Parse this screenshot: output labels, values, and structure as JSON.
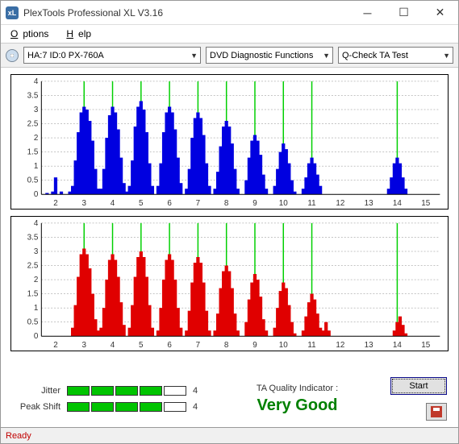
{
  "window": {
    "title": "PlexTools Professional XL V3.16"
  },
  "menu": {
    "options": "Options",
    "help": "Help"
  },
  "toolbar": {
    "device": "HA:7 ID:0   PX-760A",
    "function": "DVD Diagnostic Functions",
    "test": "Q-Check TA Test"
  },
  "chart_data": [
    {
      "type": "bar",
      "color": "#0000e0",
      "xlim": [
        1.5,
        15.5
      ],
      "ylim": [
        0,
        4
      ],
      "xticks": [
        2,
        3,
        4,
        5,
        6,
        7,
        8,
        9,
        10,
        11,
        12,
        13,
        14,
        15
      ],
      "yticks": [
        0,
        0.5,
        1,
        1.5,
        2,
        2.5,
        3,
        3.5,
        4
      ],
      "gridx": [
        3,
        4,
        5,
        6,
        7,
        8,
        9,
        10,
        11,
        14
      ],
      "series": [
        {
          "x": 1.7,
          "y": 0.05
        },
        {
          "x": 1.9,
          "y": 0.1
        },
        {
          "x": 2.0,
          "y": 0.6
        },
        {
          "x": 2.2,
          "y": 0.1
        },
        {
          "x": 2.5,
          "y": 0.1
        },
        {
          "x": 2.6,
          "y": 0.3
        },
        {
          "x": 2.7,
          "y": 1.2
        },
        {
          "x": 2.8,
          "y": 2.2
        },
        {
          "x": 2.9,
          "y": 2.9
        },
        {
          "x": 3.0,
          "y": 3.1
        },
        {
          "x": 3.1,
          "y": 3.0
        },
        {
          "x": 3.2,
          "y": 2.6
        },
        {
          "x": 3.3,
          "y": 1.9
        },
        {
          "x": 3.4,
          "y": 0.9
        },
        {
          "x": 3.5,
          "y": 0.2
        },
        {
          "x": 3.6,
          "y": 0.2
        },
        {
          "x": 3.7,
          "y": 0.9
        },
        {
          "x": 3.8,
          "y": 2.0
        },
        {
          "x": 3.9,
          "y": 2.8
        },
        {
          "x": 4.0,
          "y": 3.1
        },
        {
          "x": 4.1,
          "y": 2.9
        },
        {
          "x": 4.2,
          "y": 2.3
        },
        {
          "x": 4.3,
          "y": 1.3
        },
        {
          "x": 4.4,
          "y": 0.4
        },
        {
          "x": 4.5,
          "y": 0.1
        },
        {
          "x": 4.6,
          "y": 0.3
        },
        {
          "x": 4.7,
          "y": 1.2
        },
        {
          "x": 4.8,
          "y": 2.4
        },
        {
          "x": 4.9,
          "y": 3.1
        },
        {
          "x": 5.0,
          "y": 3.3
        },
        {
          "x": 5.1,
          "y": 3.0
        },
        {
          "x": 5.2,
          "y": 2.2
        },
        {
          "x": 5.3,
          "y": 1.1
        },
        {
          "x": 5.4,
          "y": 0.3
        },
        {
          "x": 5.6,
          "y": 0.3
        },
        {
          "x": 5.7,
          "y": 1.1
        },
        {
          "x": 5.8,
          "y": 2.2
        },
        {
          "x": 5.9,
          "y": 2.9
        },
        {
          "x": 6.0,
          "y": 3.1
        },
        {
          "x": 6.1,
          "y": 2.9
        },
        {
          "x": 6.2,
          "y": 2.3
        },
        {
          "x": 6.3,
          "y": 1.3
        },
        {
          "x": 6.4,
          "y": 0.4
        },
        {
          "x": 6.6,
          "y": 0.2
        },
        {
          "x": 6.7,
          "y": 0.9
        },
        {
          "x": 6.8,
          "y": 2.0
        },
        {
          "x": 6.9,
          "y": 2.7
        },
        {
          "x": 7.0,
          "y": 2.9
        },
        {
          "x": 7.1,
          "y": 2.7
        },
        {
          "x": 7.2,
          "y": 2.1
        },
        {
          "x": 7.3,
          "y": 1.1
        },
        {
          "x": 7.4,
          "y": 0.3
        },
        {
          "x": 7.6,
          "y": 0.2
        },
        {
          "x": 7.7,
          "y": 0.8
        },
        {
          "x": 7.8,
          "y": 1.7
        },
        {
          "x": 7.9,
          "y": 2.4
        },
        {
          "x": 8.0,
          "y": 2.6
        },
        {
          "x": 8.1,
          "y": 2.4
        },
        {
          "x": 8.2,
          "y": 1.8
        },
        {
          "x": 8.3,
          "y": 0.9
        },
        {
          "x": 8.4,
          "y": 0.2
        },
        {
          "x": 8.7,
          "y": 0.5
        },
        {
          "x": 8.8,
          "y": 1.3
        },
        {
          "x": 8.9,
          "y": 1.9
        },
        {
          "x": 9.0,
          "y": 2.1
        },
        {
          "x": 9.1,
          "y": 1.9
        },
        {
          "x": 9.2,
          "y": 1.4
        },
        {
          "x": 9.3,
          "y": 0.7
        },
        {
          "x": 9.4,
          "y": 0.2
        },
        {
          "x": 9.7,
          "y": 0.3
        },
        {
          "x": 9.8,
          "y": 0.9
        },
        {
          "x": 9.9,
          "y": 1.5
        },
        {
          "x": 10.0,
          "y": 1.8
        },
        {
          "x": 10.1,
          "y": 1.6
        },
        {
          "x": 10.2,
          "y": 1.1
        },
        {
          "x": 10.3,
          "y": 0.5
        },
        {
          "x": 10.4,
          "y": 0.1
        },
        {
          "x": 10.7,
          "y": 0.2
        },
        {
          "x": 10.8,
          "y": 0.6
        },
        {
          "x": 10.9,
          "y": 1.1
        },
        {
          "x": 11.0,
          "y": 1.3
        },
        {
          "x": 11.1,
          "y": 1.1
        },
        {
          "x": 11.2,
          "y": 0.7
        },
        {
          "x": 11.3,
          "y": 0.3
        },
        {
          "x": 13.7,
          "y": 0.2
        },
        {
          "x": 13.8,
          "y": 0.6
        },
        {
          "x": 13.9,
          "y": 1.1
        },
        {
          "x": 14.0,
          "y": 1.3
        },
        {
          "x": 14.1,
          "y": 1.1
        },
        {
          "x": 14.2,
          "y": 0.6
        },
        {
          "x": 14.3,
          "y": 0.2
        }
      ]
    },
    {
      "type": "bar",
      "color": "#e00000",
      "xlim": [
        1.5,
        15.5
      ],
      "ylim": [
        0,
        4
      ],
      "xticks": [
        2,
        3,
        4,
        5,
        6,
        7,
        8,
        9,
        10,
        11,
        12,
        13,
        14,
        15
      ],
      "yticks": [
        0,
        0.5,
        1,
        1.5,
        2,
        2.5,
        3,
        3.5,
        4
      ],
      "gridx": [
        3,
        4,
        5,
        6,
        7,
        8,
        9,
        10,
        11,
        14
      ],
      "series": [
        {
          "x": 2.6,
          "y": 0.3
        },
        {
          "x": 2.7,
          "y": 1.1
        },
        {
          "x": 2.8,
          "y": 2.1
        },
        {
          "x": 2.9,
          "y": 2.9
        },
        {
          "x": 3.0,
          "y": 3.1
        },
        {
          "x": 3.1,
          "y": 2.9
        },
        {
          "x": 3.2,
          "y": 2.4
        },
        {
          "x": 3.3,
          "y": 1.5
        },
        {
          "x": 3.4,
          "y": 0.6
        },
        {
          "x": 3.5,
          "y": 0.2
        },
        {
          "x": 3.6,
          "y": 0.3
        },
        {
          "x": 3.7,
          "y": 1.0
        },
        {
          "x": 3.8,
          "y": 2.0
        },
        {
          "x": 3.9,
          "y": 2.7
        },
        {
          "x": 4.0,
          "y": 2.9
        },
        {
          "x": 4.1,
          "y": 2.7
        },
        {
          "x": 4.2,
          "y": 2.1
        },
        {
          "x": 4.3,
          "y": 1.2
        },
        {
          "x": 4.4,
          "y": 0.4
        },
        {
          "x": 4.6,
          "y": 0.3
        },
        {
          "x": 4.7,
          "y": 1.1
        },
        {
          "x": 4.8,
          "y": 2.1
        },
        {
          "x": 4.9,
          "y": 2.8
        },
        {
          "x": 5.0,
          "y": 3.0
        },
        {
          "x": 5.1,
          "y": 2.8
        },
        {
          "x": 5.2,
          "y": 2.1
        },
        {
          "x": 5.3,
          "y": 1.1
        },
        {
          "x": 5.4,
          "y": 0.3
        },
        {
          "x": 5.6,
          "y": 0.2
        },
        {
          "x": 5.7,
          "y": 1.0
        },
        {
          "x": 5.8,
          "y": 2.0
        },
        {
          "x": 5.9,
          "y": 2.7
        },
        {
          "x": 6.0,
          "y": 2.9
        },
        {
          "x": 6.1,
          "y": 2.7
        },
        {
          "x": 6.2,
          "y": 2.0
        },
        {
          "x": 6.3,
          "y": 1.0
        },
        {
          "x": 6.4,
          "y": 0.3
        },
        {
          "x": 6.6,
          "y": 0.2
        },
        {
          "x": 6.7,
          "y": 0.9
        },
        {
          "x": 6.8,
          "y": 1.9
        },
        {
          "x": 6.9,
          "y": 2.6
        },
        {
          "x": 7.0,
          "y": 2.8
        },
        {
          "x": 7.1,
          "y": 2.6
        },
        {
          "x": 7.2,
          "y": 1.9
        },
        {
          "x": 7.3,
          "y": 0.9
        },
        {
          "x": 7.4,
          "y": 0.2
        },
        {
          "x": 7.6,
          "y": 0.2
        },
        {
          "x": 7.7,
          "y": 0.8
        },
        {
          "x": 7.8,
          "y": 1.7
        },
        {
          "x": 7.9,
          "y": 2.3
        },
        {
          "x": 8.0,
          "y": 2.5
        },
        {
          "x": 8.1,
          "y": 2.3
        },
        {
          "x": 8.2,
          "y": 1.7
        },
        {
          "x": 8.3,
          "y": 0.8
        },
        {
          "x": 8.4,
          "y": 0.2
        },
        {
          "x": 8.7,
          "y": 0.5
        },
        {
          "x": 8.8,
          "y": 1.3
        },
        {
          "x": 8.9,
          "y": 1.9
        },
        {
          "x": 9.0,
          "y": 2.2
        },
        {
          "x": 9.1,
          "y": 2.0
        },
        {
          "x": 9.2,
          "y": 1.4
        },
        {
          "x": 9.3,
          "y": 0.6
        },
        {
          "x": 9.4,
          "y": 0.2
        },
        {
          "x": 9.7,
          "y": 0.3
        },
        {
          "x": 9.8,
          "y": 1.0
        },
        {
          "x": 9.9,
          "y": 1.6
        },
        {
          "x": 10.0,
          "y": 1.9
        },
        {
          "x": 10.1,
          "y": 1.7
        },
        {
          "x": 10.2,
          "y": 1.1
        },
        {
          "x": 10.3,
          "y": 0.5
        },
        {
          "x": 10.4,
          "y": 0.1
        },
        {
          "x": 10.7,
          "y": 0.2
        },
        {
          "x": 10.8,
          "y": 0.7
        },
        {
          "x": 10.9,
          "y": 1.2
        },
        {
          "x": 11.0,
          "y": 1.5
        },
        {
          "x": 11.1,
          "y": 1.3
        },
        {
          "x": 11.2,
          "y": 0.8
        },
        {
          "x": 11.3,
          "y": 0.3
        },
        {
          "x": 11.4,
          "y": 0.2
        },
        {
          "x": 11.5,
          "y": 0.5
        },
        {
          "x": 11.6,
          "y": 0.2
        },
        {
          "x": 13.9,
          "y": 0.2
        },
        {
          "x": 14.0,
          "y": 0.5
        },
        {
          "x": 14.1,
          "y": 0.7
        },
        {
          "x": 14.2,
          "y": 0.4
        },
        {
          "x": 14.3,
          "y": 0.1
        }
      ]
    }
  ],
  "metrics": {
    "jitter": {
      "label": "Jitter",
      "value": "4",
      "filled": 4,
      "total": 5
    },
    "peakshift": {
      "label": "Peak Shift",
      "value": "4",
      "filled": 4,
      "total": 5
    }
  },
  "quality": {
    "label": "TA Quality Indicator :",
    "value": "Very Good"
  },
  "buttons": {
    "start": "Start"
  },
  "status": "Ready"
}
